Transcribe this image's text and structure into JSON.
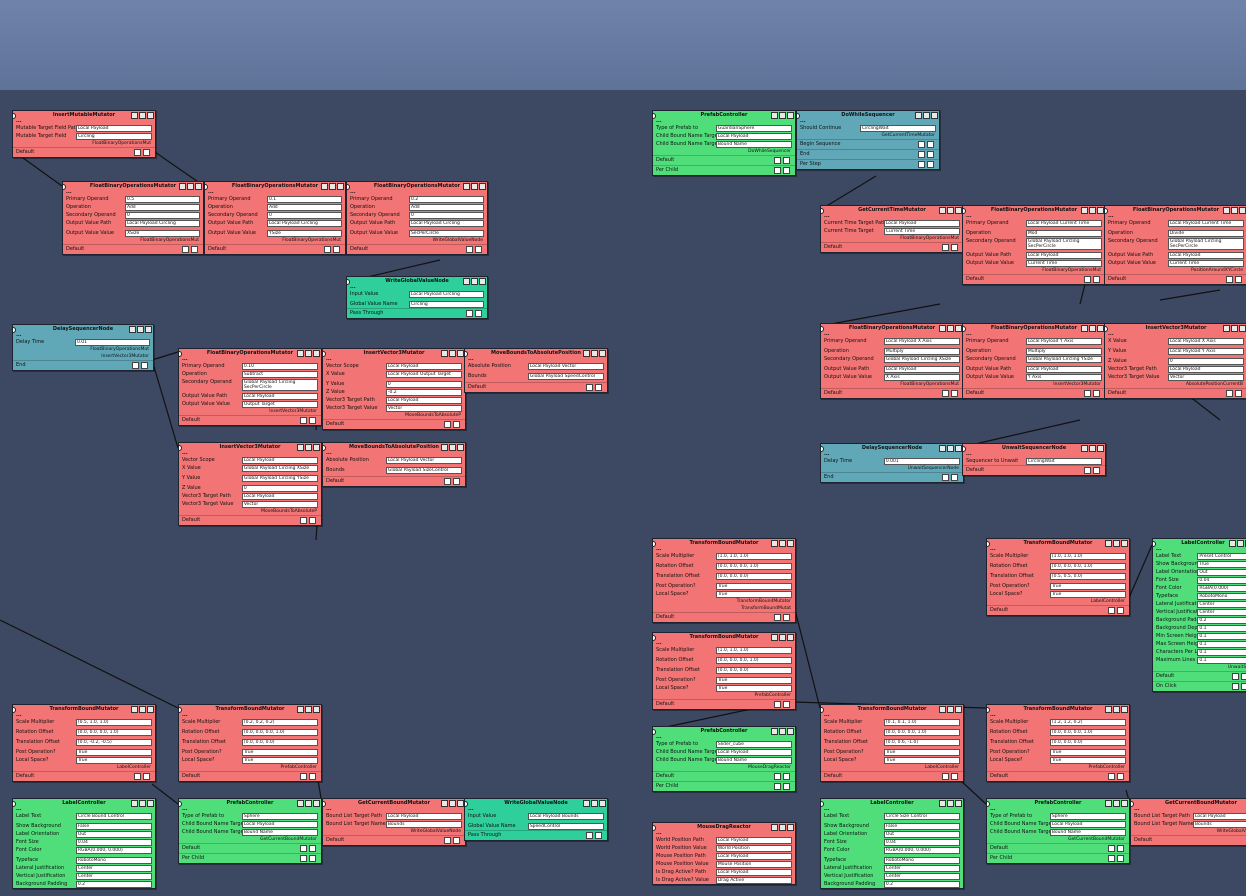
{
  "wires": {
    "stroke": "#111111"
  },
  "nodes": [
    {
      "title": "InsertMutableMutator",
      "color": "red",
      "rows": [
        [
          "Mutable Target Field Path",
          "Local Payload"
        ],
        [
          "Mutable Target Field",
          "Circling"
        ]
      ],
      "outs": [
        "FloatBinaryOperationsMut"
      ],
      "foot": "Default"
    },
    {
      "title": "FloatBinaryOperationsMutator",
      "color": "red",
      "rows": [
        [
          "Primary Operand",
          "0.5"
        ],
        [
          "Operation",
          "Add"
        ],
        [
          "Secondary Operand",
          "0"
        ],
        [
          "Output Value Path",
          "Local Payload Circling"
        ],
        [
          "Output Value Value",
          "XSize"
        ]
      ],
      "outs": [
        "FloatBinaryOperationsMut"
      ],
      "foot": "Default"
    },
    {
      "title": "FloatBinaryOperationsMutator",
      "color": "red",
      "rows": [
        [
          "Primary Operand",
          "0.1"
        ],
        [
          "Operation",
          "Add"
        ],
        [
          "Secondary Operand",
          "0"
        ],
        [
          "Output Value Path",
          "Local Payload Circling"
        ],
        [
          "Output Value Value",
          "YSize"
        ]
      ],
      "outs": [
        "FloatBinaryOperationsMut"
      ],
      "foot": "Default"
    },
    {
      "title": "FloatBinaryOperationsMutator",
      "color": "red",
      "rows": [
        [
          "Primary Operand",
          "0.2"
        ],
        [
          "Operation",
          "Add"
        ],
        [
          "Secondary Operand",
          "0"
        ],
        [
          "Output Value Path",
          "Local Payload Circling"
        ],
        [
          "Output Value Value",
          "SecPerCircle"
        ]
      ],
      "outs": [
        "WriteGlobalValueNode"
      ],
      "foot": "Default"
    },
    {
      "title": "WriteGlobalValueNode",
      "color": "mint",
      "rows": [
        [
          "Input Value",
          "Local Payload Circling"
        ],
        [
          "Global Value Name",
          "Circling"
        ]
      ],
      "outs": [],
      "foot": "Pass Through"
    },
    {
      "title": "DelaySequencerNode",
      "color": "teal",
      "rows": [
        [
          "Delay Time",
          "0.01"
        ]
      ],
      "outs": [
        "FloatBinaryOperationsMut",
        "InsertVector3Mutator"
      ],
      "foot": "End"
    },
    {
      "title": "FloatBinaryOperationsMutator",
      "color": "red",
      "rows": [
        [
          "Primary Operand",
          "0.10"
        ],
        [
          "Operation",
          "Subtract"
        ],
        [
          "Secondary Operand",
          "Global Payload Circling SecPerCircle"
        ],
        [
          "Output Value Path",
          "Local Payload"
        ],
        [
          "Output Value Value",
          "Output Target"
        ]
      ],
      "outs": [
        "InsertVector3Mutator"
      ],
      "foot": "Default"
    },
    {
      "title": "InsertVector3Mutator",
      "color": "red",
      "rows": [
        [
          "Vector Scope",
          "Local Payload"
        ],
        [
          "X Value",
          "Local Payload Output Target"
        ],
        [
          "Y Value",
          "0"
        ],
        [
          "Z Value",
          "-0.2"
        ],
        [
          "Vector3 Target Path",
          "Local Payload"
        ],
        [
          "Vector3 Target Value",
          "Vector"
        ]
      ],
      "outs": [
        "MoveBoundsToAbsoluteP"
      ],
      "foot": "Default"
    },
    {
      "title": "MoveBoundsToAbsolutePosition",
      "color": "red",
      "rows": [
        [
          "Absolute Position",
          "Local Payload Vector"
        ],
        [
          "Bounds",
          "Global Payload SpeedControl"
        ]
      ],
      "outs": [],
      "foot": "Default"
    },
    {
      "title": "InsertVector3Mutator",
      "color": "red",
      "rows": [
        [
          "Vector Scope",
          "Local Payload"
        ],
        [
          "X Value",
          "Global Payload Circling XSize"
        ],
        [
          "Y Value",
          "Global Payload Circling YSize"
        ],
        [
          "Z Value",
          "0"
        ],
        [
          "Vector3 Target Path",
          "Local Payload"
        ],
        [
          "Vector3 Target Value",
          "Vector"
        ]
      ],
      "outs": [
        "MoveBoundsToAbsoluteP"
      ],
      "foot": "Default"
    },
    {
      "title": "MoveBoundsToAbsolutePosition",
      "color": "red",
      "rows": [
        [
          "Absolute Position",
          "Local Payload Vector"
        ],
        [
          "Bounds",
          "Global Payload SizeControl"
        ]
      ],
      "outs": [],
      "foot": "Default"
    },
    {
      "title": "PrefabController",
      "color": "green",
      "rows": [
        [
          "Type of Prefab to",
          "GuardianSphere"
        ],
        [
          "Child Bound Name Target",
          "Local Payload"
        ],
        [
          "Child Bound Name Target",
          "Bound Name"
        ]
      ],
      "outs": [
        "DoWhileSequencer"
      ],
      "foot": "Default",
      "extra": "Per Child"
    },
    {
      "title": "DoWhileSequencer",
      "color": "teal",
      "rows": [
        [
          "Should Continue",
          "CirclingWait"
        ]
      ],
      "outs": [
        "GetCurrentTimeMutator"
      ],
      "foot": "Begin Sequence",
      "extra": "End",
      "extra2": "Per Step"
    },
    {
      "title": "GetCurrentTimeMutator",
      "color": "red",
      "rows": [
        [
          "Current Time Target Path",
          "Local Payload"
        ],
        [
          "Current Time Target",
          "Current Time"
        ]
      ],
      "outs": [
        "FloatBinaryOperationsMut"
      ],
      "foot": "Default"
    },
    {
      "title": "FloatBinaryOperationsMutator",
      "color": "red",
      "rows": [
        [
          "Primary Operand",
          "Local Payload Current Time"
        ],
        [
          "Operation",
          "Mod"
        ],
        [
          "Secondary Operand",
          "Global Payload Circling SecPerCircle"
        ],
        [
          "Output Value Path",
          "Local Payload"
        ],
        [
          "Output Value Value",
          "Current Time"
        ]
      ],
      "outs": [
        "FloatBinaryOperationsMut"
      ],
      "foot": "Default"
    },
    {
      "title": "FloatBinaryOperationsMutator",
      "color": "red",
      "rows": [
        [
          "Primary Operand",
          "Local Payload Current Time"
        ],
        [
          "Operation",
          "Divide"
        ],
        [
          "Secondary Operand",
          "Global Payload Circling SecPerCircle"
        ],
        [
          "Output Value Path",
          "Local Payload"
        ],
        [
          "Output Value Value",
          "Current Time"
        ]
      ],
      "outs": [
        "PositionAroundXYCircle"
      ],
      "foot": "Default"
    },
    {
      "title": "FloatBinaryOperationsMutator",
      "color": "red",
      "rows": [
        [
          "Primary Operand",
          "Local Payload X Axis"
        ],
        [
          "Operation",
          "Multiply"
        ],
        [
          "Secondary Operand",
          "Global Payload Circling XSize"
        ],
        [
          "Output Value Path",
          "Local Payload"
        ],
        [
          "Output Value Value",
          "X Axis"
        ]
      ],
      "outs": [
        "FloatBinaryOperationsMut"
      ],
      "foot": "Default"
    },
    {
      "title": "FloatBinaryOperationsMutator",
      "color": "red",
      "rows": [
        [
          "Primary Operand",
          "Local Payload Y Axis"
        ],
        [
          "Operation",
          "Multiply"
        ],
        [
          "Secondary Operand",
          "Global Payload Circling YSize"
        ],
        [
          "Output Value Path",
          "Local Payload"
        ],
        [
          "Output Value Value",
          "Y Axis"
        ]
      ],
      "outs": [
        "InsertVector3Mutator"
      ],
      "foot": "Default"
    },
    {
      "title": "InsertVector3Mutator",
      "color": "red",
      "rows": [
        [
          "X Value",
          "Local Payload X Axis"
        ],
        [
          "Y Value",
          "Local Payload Y Axis"
        ],
        [
          "Z Value",
          "0"
        ],
        [
          "Vector3 Target Path",
          "Local Payload"
        ],
        [
          "Vector3 Target Value",
          "Vector"
        ]
      ],
      "outs": [
        "AbsolutePositionCurrentB"
      ],
      "foot": "Default"
    },
    {
      "title": "DelaySequencerNode",
      "color": "teal",
      "rows": [
        [
          "Delay Time",
          "0.001"
        ]
      ],
      "outs": [
        "UnwaitSequencerNode"
      ],
      "foot": "End"
    },
    {
      "title": "UnwaitSequencerNode",
      "color": "red",
      "rows": [
        [
          "Sequencer to Unwait",
          "CirclingWait"
        ]
      ],
      "outs": [],
      "foot": "Default"
    },
    {
      "title": "TransformBoundMutator",
      "color": "red",
      "rows": [
        [
          "Scale Multiplier",
          "(1.0, 1.0, 1.0)"
        ],
        [
          "Rotation Offset",
          "(0.0, 0.0, 0.0, 1.0)"
        ],
        [
          "Translation Offset",
          "(0.0, 0.0, 0.0)"
        ],
        [
          "Post Operation?",
          "True"
        ],
        [
          "Local Space?",
          "True"
        ]
      ],
      "outs": [
        "TransformBoundMutator",
        "TransformBoundMutat"
      ],
      "foot": "Default"
    },
    {
      "title": "TransformBoundMutator",
      "color": "red",
      "rows": [
        [
          "Scale Multiplier",
          "(1.0, 1.0, 1.0)"
        ],
        [
          "Rotation Offset",
          "(0.0, 0.0, 0.0, 1.0)"
        ],
        [
          "Translation Offset",
          "(0.0, 0.0, 0.0)"
        ],
        [
          "Post Operation?",
          "True"
        ],
        [
          "Local Space?",
          "True"
        ]
      ],
      "outs": [
        "PrefabController"
      ],
      "foot": "Default"
    },
    {
      "title": "LabelController",
      "color": "green",
      "rows": [
        [
          "Label Text",
          "Preset Control"
        ],
        [
          "Show Background",
          "True"
        ],
        [
          "Label Orientation",
          "Out"
        ],
        [
          "Font Size",
          "0.04"
        ],
        [
          "Font Color",
          "RGBA(0.000)"
        ],
        [
          "Typeface",
          "RobotoMono"
        ],
        [
          "Lateral Justification",
          "Center"
        ],
        [
          "Vertical Justification",
          "Center"
        ],
        [
          "Background Padding",
          "0.2"
        ],
        [
          "Background Depth",
          "0.1"
        ],
        [
          "Min Screen Height",
          "0.1"
        ],
        [
          "Max Screen Height",
          "0.1"
        ],
        [
          "Characters Per Line",
          "0.1"
        ],
        [
          "Maximum Lines to Render",
          "0.1"
        ]
      ],
      "outs": [
        "UnwaitSe"
      ],
      "foot": "Default",
      "extra": "On Click"
    },
    {
      "title": "TransformBoundMutator",
      "color": "red",
      "rows": [
        [
          "Scale Multiplier",
          "(1.0, 1.0, 1.0)"
        ],
        [
          "Rotation Offset",
          "(0.0, 0.0, 0.0, 1.0)"
        ],
        [
          "Translation Offset",
          "(0.5, 0.5, 0.0)"
        ],
        [
          "Post Operation?",
          "True"
        ],
        [
          "Local Space?",
          "True"
        ]
      ],
      "outs": [
        "LabelController"
      ],
      "foot": "Default"
    },
    {
      "title": "TransformBoundMutator",
      "color": "red",
      "rows": [
        [
          "Scale Multiplier",
          "(0.5, 1.0, 1.0)"
        ],
        [
          "Rotation Offset",
          "(0.0, 0.0, 0.0, 1.0)"
        ],
        [
          "Translation Offset",
          "(0.0, -0.2, -0.5)"
        ],
        [
          "Post Operation?",
          "True"
        ],
        [
          "Local Space?",
          "True"
        ]
      ],
      "outs": [
        "LabelController"
      ],
      "foot": "Default"
    },
    {
      "title": "TransformBoundMutator",
      "color": "red",
      "rows": [
        [
          "Scale Multiplier",
          "(0.2, 0.2, 0.2)"
        ],
        [
          "Rotation Offset",
          "(0.0, 0.0, 0.0, 1.0)"
        ],
        [
          "Translation Offset",
          "(0.0, 0.0, 0.0)"
        ],
        [
          "Post Operation?",
          "True"
        ],
        [
          "Local Space?",
          "True"
        ]
      ],
      "outs": [
        "PrefabController"
      ],
      "foot": "Default"
    },
    {
      "title": "PrefabController",
      "color": "green",
      "rows": [
        [
          "Type of Prefab to",
          "Slider_cube"
        ],
        [
          "Child Bound Name Target",
          "Local Payload"
        ],
        [
          "Child Bound Name Target",
          "Bound Name"
        ]
      ],
      "outs": [
        "MouseDragReactor"
      ],
      "foot": "Default",
      "extra": "Per Child"
    },
    {
      "title": "TransformBoundMutator",
      "color": "red",
      "rows": [
        [
          "Scale Multiplier",
          "(0.1, 0.1, 1.0)"
        ],
        [
          "Rotation Offset",
          "(0.0, 0.0, 0.0, 1.0)"
        ],
        [
          "Translation Offset",
          "(0.0, 0.6, -1.0)"
        ],
        [
          "Post Operation?",
          "True"
        ],
        [
          "Local Space?",
          "True"
        ]
      ],
      "outs": [
        "LabelController"
      ],
      "foot": "Default"
    },
    {
      "title": "TransformBoundMutator",
      "color": "red",
      "rows": [
        [
          "Scale Multiplier",
          "(1.2, 1.2, 0.2)"
        ],
        [
          "Rotation Offset",
          "(0.0, 0.0, 0.0, 1.0)"
        ],
        [
          "Translation Offset",
          "(0.0, 0.0, 0.0)"
        ],
        [
          "Post Operation?",
          "True"
        ],
        [
          "Local Space?",
          "True"
        ]
      ],
      "outs": [
        "PrefabController"
      ],
      "foot": "Default"
    },
    {
      "title": "LabelController",
      "color": "green",
      "rows": [
        [
          "Label Text",
          "Circle Bound Control"
        ],
        [
          "Show Background",
          "False"
        ],
        [
          "Label Orientation",
          "Out"
        ],
        [
          "Font Size",
          "0.04"
        ],
        [
          "Font Color",
          "RGBA(0.000, 0.000)"
        ],
        [
          "Typeface",
          "RobotoMono"
        ],
        [
          "Lateral Justification",
          "Center"
        ],
        [
          "Vertical Justification",
          "Center"
        ],
        [
          "Background Padding",
          "0.2"
        ]
      ],
      "outs": [],
      "foot": ""
    },
    {
      "title": "PrefabController",
      "color": "green",
      "rows": [
        [
          "Type of Prefab to",
          "Sphere"
        ],
        [
          "Child Bound Name Target",
          "Local Payload"
        ],
        [
          "Child Bound Name Target",
          "Bound Name"
        ]
      ],
      "outs": [
        "GetCurrentBoundMutator"
      ],
      "foot": "Default",
      "extra": "Per Child"
    },
    {
      "title": "GetCurrentBoundMutator",
      "color": "red",
      "rows": [
        [
          "Bound List Target Path",
          "Local Payload"
        ],
        [
          "Bound List Target Name",
          "Bounds"
        ]
      ],
      "outs": [
        "WriteGlobalValueNode"
      ],
      "foot": "Default"
    },
    {
      "title": "WriteGlobalValueNode",
      "color": "mint",
      "rows": [
        [
          "Input Value",
          "Local Payload Bounds"
        ],
        [
          "Global Value Name",
          "SpeedControl"
        ]
      ],
      "outs": [],
      "foot": "Pass Through"
    },
    {
      "title": "MouseDragReactor",
      "color": "red",
      "rows": [
        [
          "World Position Path",
          "Local Payload"
        ],
        [
          "World Position Value",
          "World Position"
        ],
        [
          "Mouse Position Path",
          "Local Payload"
        ],
        [
          "Mouse Position Value",
          "Mouse Position"
        ],
        [
          "Is Drag Active? Path",
          "Local Payload"
        ],
        [
          "Is Drag Active? Value",
          "Drag Active"
        ]
      ],
      "outs": [],
      "foot": ""
    },
    {
      "title": "LabelController",
      "color": "green",
      "rows": [
        [
          "Label Text",
          "Circle Size Control"
        ],
        [
          "Show Background",
          "False"
        ],
        [
          "Label Orientation",
          "Out"
        ],
        [
          "Font Size",
          "0.04"
        ],
        [
          "Font Color",
          "RGBA(0.000, 0.000)"
        ],
        [
          "Typeface",
          "RobotoMono"
        ],
        [
          "Lateral Justification",
          "Center"
        ],
        [
          "Vertical Justification",
          "Center"
        ],
        [
          "Background Padding",
          "0.2"
        ]
      ],
      "outs": [],
      "foot": ""
    },
    {
      "title": "PrefabController",
      "color": "green",
      "rows": [
        [
          "Type of Prefab to",
          "Sphere"
        ],
        [
          "Child Bound Name Target",
          "Local Payload"
        ],
        [
          "Child Bound Name Target",
          "Bound Name"
        ]
      ],
      "outs": [
        "GetCurrentBoundMutator"
      ],
      "foot": "Default",
      "extra": "Per Child"
    },
    {
      "title": "GetCurrentBoundMutator",
      "color": "red",
      "rows": [
        [
          "Bound List Target Path",
          "Local Payload"
        ],
        [
          "Bound List Target Name",
          "Bounds"
        ]
      ],
      "outs": [
        "WriteGlobalValueNode"
      ],
      "foot": "Default"
    }
  ]
}
